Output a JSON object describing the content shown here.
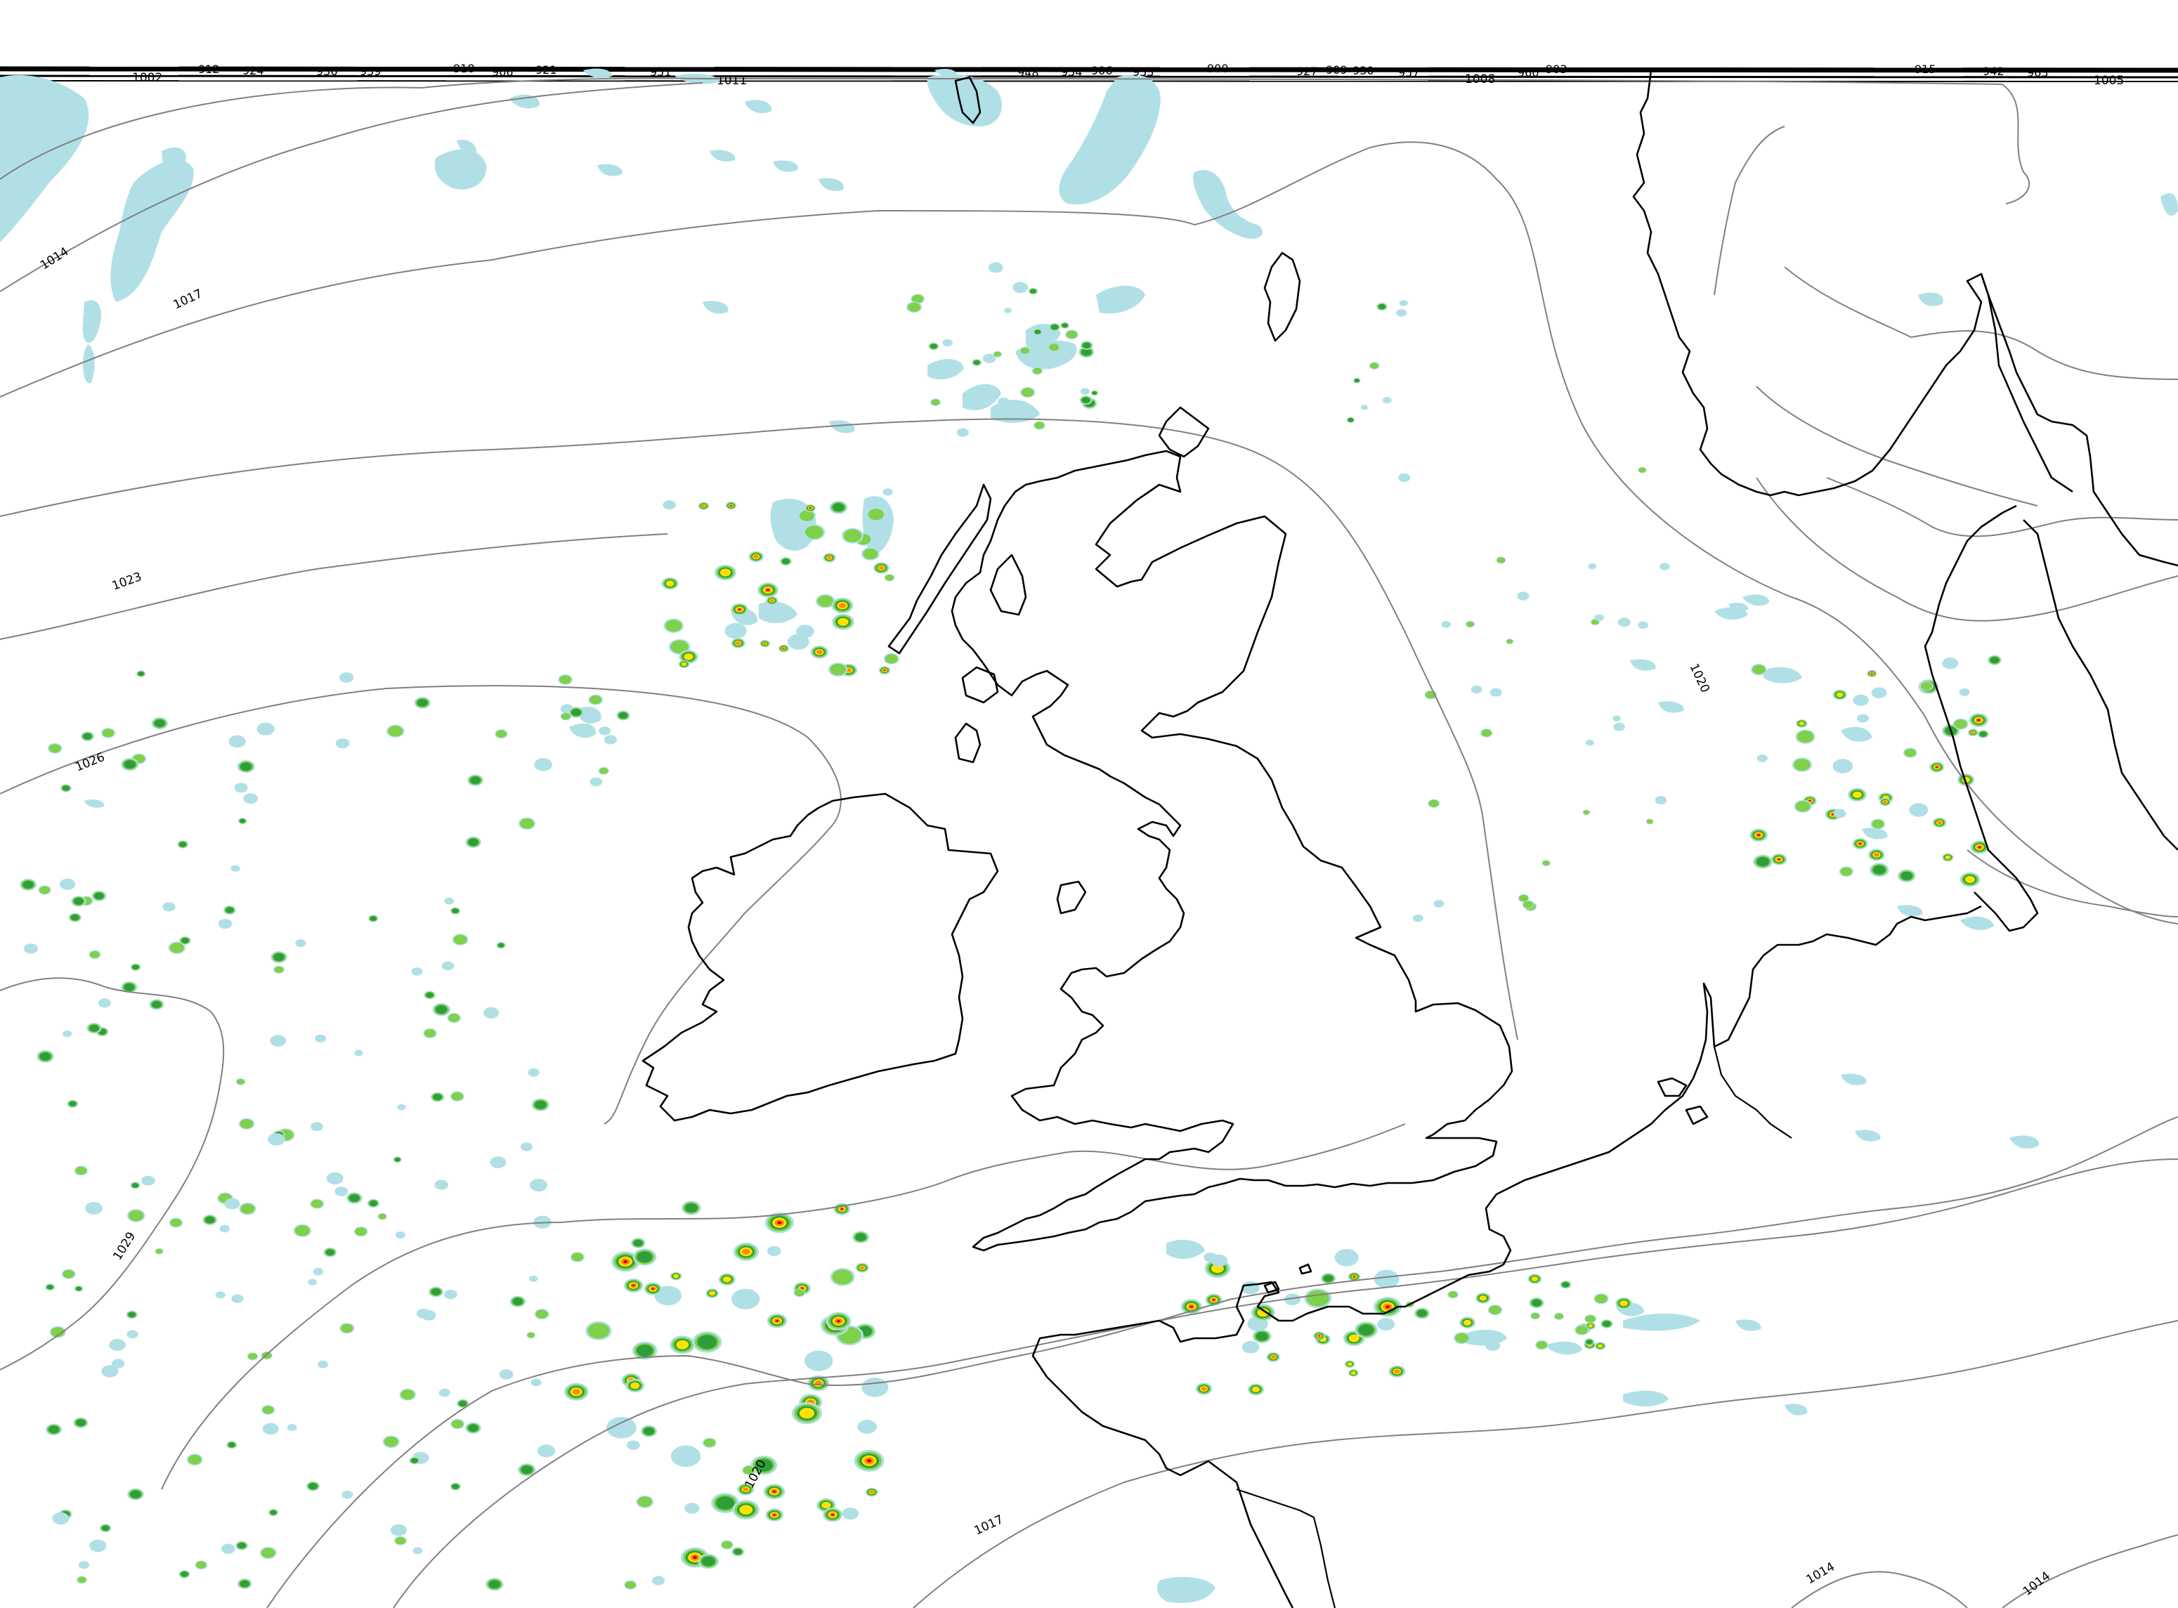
{
  "map": {
    "title": "",
    "layers": [
      "mean-sea-level-pressure-isobars",
      "precipitation-intensity",
      "coastlines"
    ],
    "precip_colors": {
      "light": "#b0e0e6",
      "moderate": "#7fd04a",
      "heavy": "#2e9e3a",
      "intense": "#ffe200",
      "very_intense": "#ff8c00",
      "extreme": "#cc0000"
    },
    "isobar_color": "#808080",
    "coast_color": "#000000",
    "isobar_labels": [
      "1002",
      "1011",
      "1014",
      "1017",
      "1020",
      "1023",
      "1026",
      "1029",
      "1017",
      "1020",
      "1014",
      "1014",
      "1005",
      "1008"
    ],
    "top_band_labels": [
      "1002",
      "912",
      "924",
      "936",
      "939",
      "918",
      "966",
      "921",
      "1011",
      "951",
      "948",
      "954",
      "906",
      "933",
      "900",
      "927",
      "909",
      "930",
      "957",
      "1008",
      "960",
      "903",
      "915",
      "942",
      "963",
      "1005"
    ]
  }
}
